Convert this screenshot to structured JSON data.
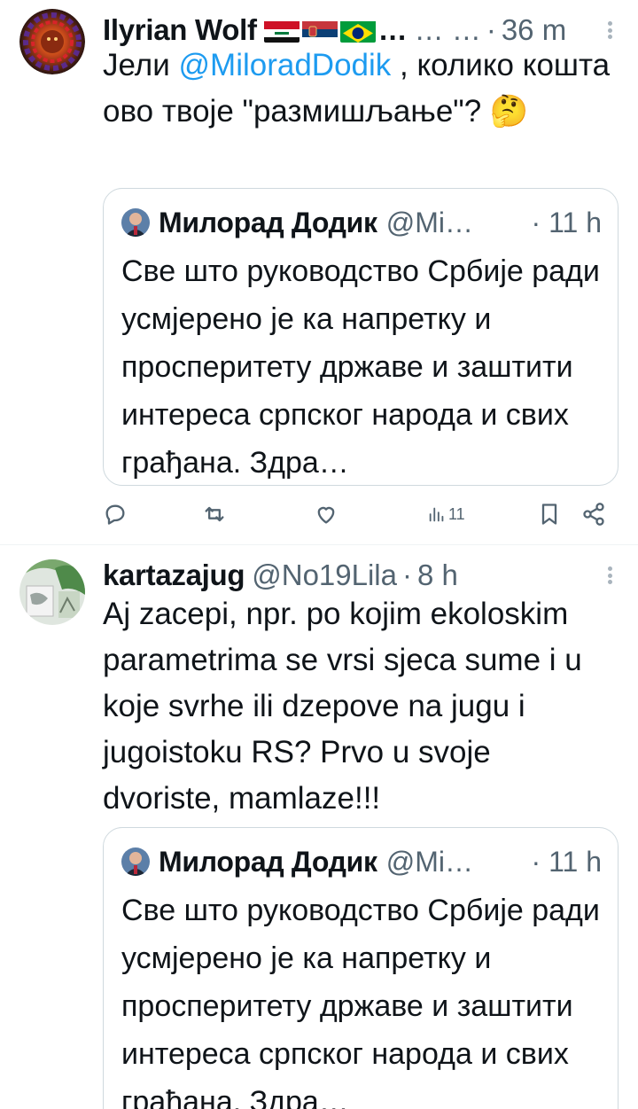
{
  "tweets": [
    {
      "name": "Ilyrian Wolf",
      "flags": [
        "iraq-flag",
        "serbia-flag",
        "brazil-flag"
      ],
      "handle": "… …",
      "separator": "·",
      "time": "36 m",
      "body_prefix": "Јели ",
      "mention": "@MiloradDodik",
      "body_suffix": " , колико кошта ово твоје \"размишљање\"? 🤔",
      "quote": {
        "name": "Милорад Додик",
        "handle": "@Mi…",
        "separator": "·",
        "time": "11 h",
        "body": "Све што руководство Србије ради усмјерено је ка напретку и просперитету државе и заштити интереса српског народа и свих грађана. Здра…"
      },
      "actions": {
        "views": "11"
      }
    },
    {
      "name": "kartazajug",
      "handle": "@No19Lila",
      "separator": "·",
      "time": "8 h",
      "body": "Aj zacepi,  npr. po kojim ekoloskim parametrima se vrsi sjeca sume i u koje svrhe ili dzepove na jugu i jugoistoku RS? Prvo u svoje dvoriste, mamlaze!!!",
      "quote": {
        "name": "Милорад Додик",
        "handle": "@Mi…",
        "separator": "·",
        "time": "11 h",
        "body": "Све што руководство Србије ради усмјерено је ка напретку и просперитету државе и заштити интереса српског народа и свих грађана. Здра…"
      }
    }
  ],
  "colors": {
    "link": "#1d9bf0",
    "muted": "#536471",
    "border": "#cfd9de"
  }
}
